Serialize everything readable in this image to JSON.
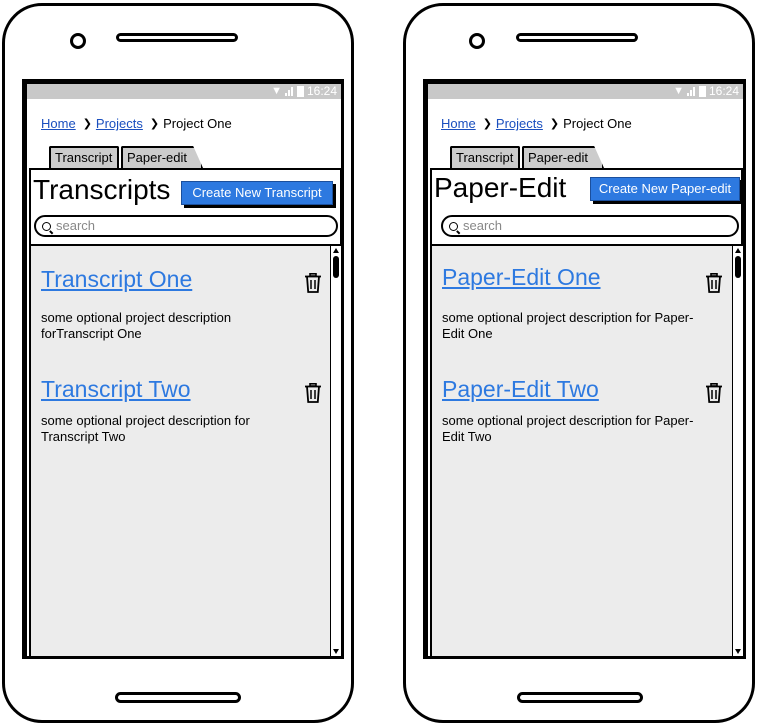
{
  "status": {
    "time": "16:24"
  },
  "breadcrumb": {
    "home": "Home",
    "projects": "Projects",
    "current": "Project One"
  },
  "tabs": {
    "transcript": "Transcript",
    "paper_edit": "Paper-edit"
  },
  "left": {
    "title": "Transcripts",
    "create_button": "Create New Transcript",
    "search_placeholder": "search",
    "items": [
      {
        "title": "Transcript One",
        "line1": "some optional project description",
        "line2": "forTranscript One"
      },
      {
        "title": "Transcript Two",
        "line1": "some optional project description for",
        "line2": "Transcript Two"
      }
    ]
  },
  "right": {
    "title": "Paper-Edit",
    "create_button": "Create New Paper-edit",
    "search_placeholder": "search",
    "items": [
      {
        "title": "Paper-Edit One",
        "line1": "some optional project description for Paper-",
        "line2": "Edit One"
      },
      {
        "title": "Paper-Edit Two",
        "line1": "some optional project description for Paper-",
        "line2": "Edit Two"
      }
    ]
  },
  "colors": {
    "accent": "#2d79e0",
    "link": "#1a4fbf",
    "list_bg": "#ececec",
    "status_bar": "#c8c8c8"
  },
  "icons": [
    "wifi-icon",
    "signal-icon",
    "battery-icon",
    "chevron-right-icon",
    "search-icon",
    "trash-icon"
  ]
}
